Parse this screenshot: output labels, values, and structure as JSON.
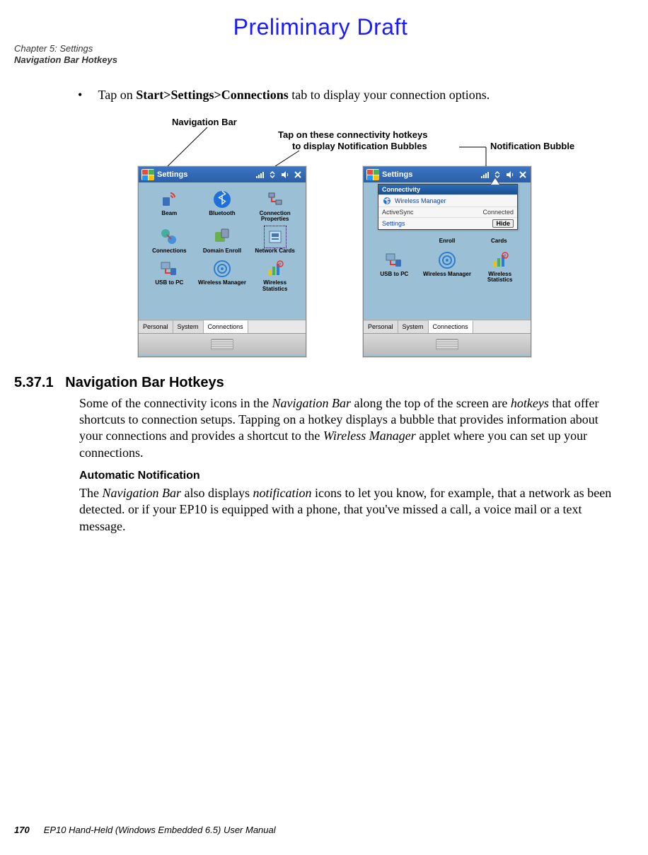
{
  "preliminary": "Preliminary Draft",
  "header": {
    "chapter": "Chapter 5:  Settings",
    "section": "Navigation Bar Hotkeys"
  },
  "instruction": {
    "pre": "Tap on ",
    "bold": "Start>Settings>Connections",
    "post": " tab to display your connection options."
  },
  "callouts": {
    "navbar": "Navigation Bar",
    "hotkeys1": "Tap on these connectivity hotkeys",
    "hotkeys2": "to display Notification Bubbles",
    "bubble": "Notification Bubble"
  },
  "screen": {
    "title": "Settings",
    "apps": {
      "beam": "Beam",
      "bluetooth": "Bluetooth",
      "connprops": "Connection Properties",
      "connections": "Connections",
      "domain": "Domain Enroll",
      "netcards": "Network Cards",
      "usb": "USB to PC",
      "wmgr": "Wireless Manager",
      "wstats": "Wireless Statistics"
    },
    "tabs": {
      "personal": "Personal",
      "system": "System",
      "connections": "Connections"
    },
    "partial": {
      "enroll": "Enroll",
      "cards": "Cards"
    }
  },
  "bubble": {
    "title": "Connectivity",
    "row1": "Wireless Manager",
    "row2_label": "ActiveSync",
    "row2_value": "Connected",
    "row3": "Settings",
    "hide": "Hide"
  },
  "section": {
    "num": "5.37.1",
    "title": "Navigation Bar Hotkeys"
  },
  "para1": {
    "a": "Some of the connectivity icons in the ",
    "b": "Navigation Bar",
    "c": " along the top of the screen are ",
    "d": "hotkeys",
    "e": " that offer shortcuts to connection setups. Tapping on a hotkey displays a bubble that provides information about your connections and provides a shortcut to the ",
    "f": "Wireless Manager",
    "g": " applet where you can set up your connections."
  },
  "auto_title": "Automatic Notification",
  "para2": {
    "a": "The ",
    "b": "Navigation Bar",
    "c": " also displays ",
    "d": "notification",
    "e": " icons to let you know, for example, that a network as been detected. or if your EP10 is equipped with a phone, that you've missed a call, a voice mail or a text message."
  },
  "footer": {
    "page": "170",
    "book": "EP10 Hand-Held (Windows Embedded 6.5) User Manual"
  }
}
